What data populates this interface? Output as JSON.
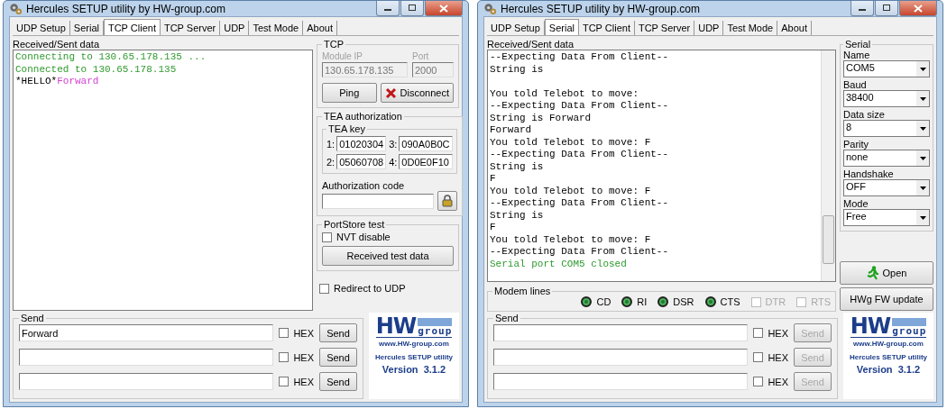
{
  "windows": [
    {
      "kind": "tcp_client",
      "title": "Hercules SETUP utility by HW-group.com",
      "tabs": [
        {
          "label": "UDP Setup",
          "selected": false
        },
        {
          "label": "Serial",
          "selected": false
        },
        {
          "label": "TCP Client",
          "selected": true
        },
        {
          "label": "TCP Server",
          "selected": false
        },
        {
          "label": "UDP",
          "selected": false
        },
        {
          "label": "Test Mode",
          "selected": false
        },
        {
          "label": "About",
          "selected": false
        }
      ],
      "log_label": "Received/Sent data",
      "log": [
        [
          {
            "kind": "status",
            "text": "Connecting to 130.65.178.135 ..."
          }
        ],
        [
          {
            "kind": "status",
            "text": "Connected to 130.65.178.135"
          }
        ],
        [
          {
            "kind": "received",
            "text": "*HELLO*"
          },
          {
            "kind": "sent",
            "text": "Forward"
          }
        ]
      ],
      "tcp": {
        "title": "TCP",
        "module_ip_label": "Module IP",
        "module_ip": "130.65.178.135",
        "port_label": "Port",
        "port": "2000",
        "disabled": true,
        "ping": "Ping",
        "disconnect": "Disconnect"
      },
      "tea": {
        "title": "TEA authorization",
        "key_title": "TEA key",
        "keys": [
          {
            "label": "1:",
            "value": "01020304"
          },
          {
            "label": "3:",
            "value": "090A0B0C"
          },
          {
            "label": "2:",
            "value": "05060708"
          },
          {
            "label": "4:",
            "value": "0D0E0F10"
          }
        ],
        "auth_label": "Authorization code"
      },
      "portstore": {
        "title": "PortStore test",
        "nvt": {
          "label": "NVT disable",
          "checked": false
        },
        "button": "Received test data"
      },
      "redirect": {
        "label": "Redirect to UDP",
        "checked": false
      },
      "send": {
        "title": "Send",
        "rows": [
          {
            "value": "Forward",
            "hex_label": "HEX",
            "hex": false,
            "button": "Send",
            "disabled": false
          },
          {
            "hex_label": "HEX",
            "hex": false,
            "button": "Send",
            "disabled": false
          },
          {
            "hex_label": "HEX",
            "hex": false,
            "button": "Send",
            "disabled": false
          }
        ]
      },
      "logo": {
        "brand": "HW",
        "brand_small": "group",
        "url": "www.HW-group.com",
        "product": "Hercules SETUP utility",
        "version": "Version  3.1.2"
      }
    },
    {
      "kind": "serial",
      "title": "Hercules SETUP utility by HW-group.com",
      "tabs": [
        {
          "label": "UDP Setup",
          "selected": false
        },
        {
          "label": "Serial",
          "selected": true
        },
        {
          "label": "TCP Client",
          "selected": false
        },
        {
          "label": "TCP Server",
          "selected": false
        },
        {
          "label": "UDP",
          "selected": false
        },
        {
          "label": "Test Mode",
          "selected": false
        },
        {
          "label": "About",
          "selected": false
        }
      ],
      "log_label": "Received/Sent data",
      "log": [
        [
          {
            "kind": "received",
            "text": "--Expecting Data From Client--"
          }
        ],
        [
          {
            "kind": "received",
            "text": "String is"
          }
        ],
        [
          {
            "kind": "blank"
          }
        ],
        [
          {
            "kind": "received",
            "text": "You told Telebot to move:"
          }
        ],
        [
          {
            "kind": "received",
            "text": "--Expecting Data From Client--"
          }
        ],
        [
          {
            "kind": "received",
            "text": "String is Forward"
          }
        ],
        [
          {
            "kind": "received",
            "text": "Forward"
          }
        ],
        [
          {
            "kind": "received",
            "text": "You told Telebot to move: F"
          }
        ],
        [
          {
            "kind": "received",
            "text": "--Expecting Data From Client--"
          }
        ],
        [
          {
            "kind": "received",
            "text": "String is"
          }
        ],
        [
          {
            "kind": "received",
            "text": "F"
          }
        ],
        [
          {
            "kind": "received",
            "text": "You told Telebot to move: F"
          }
        ],
        [
          {
            "kind": "received",
            "text": "--Expecting Data From Client--"
          }
        ],
        [
          {
            "kind": "received",
            "text": "String is"
          }
        ],
        [
          {
            "kind": "received",
            "text": "F"
          }
        ],
        [
          {
            "kind": "received",
            "text": "You told Telebot to move: F"
          }
        ],
        [
          {
            "kind": "received",
            "text": "--Expecting Data From Client--"
          }
        ],
        [
          {
            "kind": "status",
            "text": "Serial port COM5 closed"
          }
        ]
      ],
      "modem": {
        "title": "Modem lines",
        "leds": [
          {
            "label": "CD",
            "on": true
          },
          {
            "label": "RI",
            "on": true
          },
          {
            "label": "DSR",
            "on": true
          },
          {
            "label": "CTS",
            "on": true
          }
        ],
        "checks": [
          {
            "label": "DTR",
            "checked": false,
            "disabled": true
          },
          {
            "label": "RTS",
            "checked": false,
            "disabled": true
          }
        ]
      },
      "serial": {
        "title": "Serial",
        "fields": [
          {
            "label": "Name",
            "value": "COM5"
          },
          {
            "label": "Baud",
            "value": "38400"
          },
          {
            "label": "Data size",
            "value": "8"
          },
          {
            "label": "Parity",
            "value": "none"
          },
          {
            "label": "Handshake",
            "value": "OFF"
          },
          {
            "label": "Mode",
            "value": "Free"
          }
        ],
        "open": "Open",
        "fw_update": "HWg FW update"
      },
      "send": {
        "title": "Send",
        "rows": [
          {
            "hex_label": "HEX",
            "hex": false,
            "button": "Send",
            "disabled": true
          },
          {
            "hex_label": "HEX",
            "hex": false,
            "button": "Send",
            "disabled": true
          },
          {
            "hex_label": "HEX",
            "hex": false,
            "button": "Send",
            "disabled": true
          }
        ]
      },
      "logo": {
        "brand": "HW",
        "brand_small": "group",
        "url": "www.HW-group.com",
        "product": "Hercules SETUP utility",
        "version": "Version  3.1.2"
      }
    }
  ]
}
